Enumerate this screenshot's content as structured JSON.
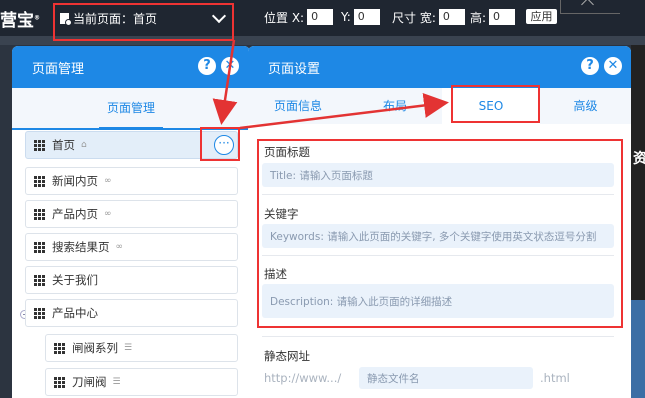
{
  "toolbar": {
    "logo_text": "营宝",
    "logo_mark": "®",
    "current_page_label": "当前页面：首页",
    "pos_x_label": "位置 X:",
    "pos_x_value": "0",
    "pos_y_label": "Y:",
    "pos_y_value": "0",
    "size_w_label": "尺寸 宽:",
    "size_w_value": "0",
    "size_h_label": "高:",
    "size_h_value": "0",
    "apply_label": "应用"
  },
  "left_panel": {
    "title": "页面管理",
    "help_label": "?",
    "close_label": "✕",
    "tab_label": "页面管理",
    "more_label": "···",
    "items": [
      {
        "label": "首页",
        "icon": "home-icon"
      },
      {
        "label": "新闻内页",
        "icon": "link-icon"
      },
      {
        "label": "产品内页",
        "icon": "link-icon"
      },
      {
        "label": "搜索结果页",
        "icon": "link-icon"
      },
      {
        "label": "关于我们",
        "icon": ""
      },
      {
        "label": "产品中心",
        "icon": ""
      },
      {
        "label": "闸阀系列",
        "icon": "list-icon"
      },
      {
        "label": "刀闸阀",
        "icon": "list-icon"
      }
    ]
  },
  "right_panel": {
    "title": "页面设置",
    "help_label": "?",
    "close_label": "✕",
    "tabs": [
      "页面信息",
      "布局",
      "SEO",
      "高级"
    ],
    "active_tab": "SEO",
    "seo": {
      "title_label": "页面标题",
      "title_placeholder": "Title: 请输入页面标题",
      "keywords_label": "关键字",
      "keywords_placeholder": "Keywords: 请输入此页面的关键字, 多个关键字使用英文状态逗号分割",
      "description_label": "描述",
      "description_placeholder": "Description: 请输入此页面的详细描述"
    },
    "static_url": {
      "label": "静态网址",
      "prefix": "http://www.../",
      "placeholder": "静态文件名",
      "suffix": ".html"
    }
  },
  "stage": {
    "edge_char": "资"
  },
  "colors": {
    "accent": "#1e88e5",
    "annotation_red": "#e33333"
  }
}
